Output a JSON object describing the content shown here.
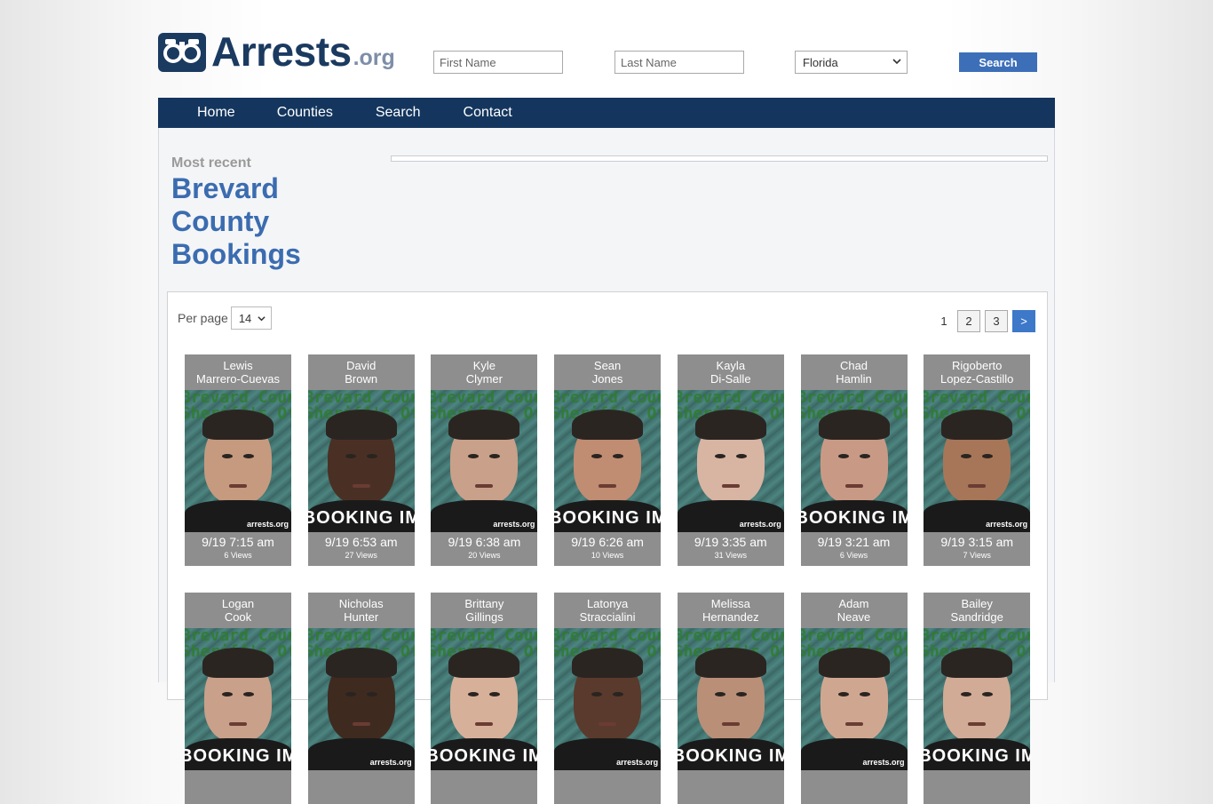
{
  "site": {
    "logo_text": "Arrests",
    "logo_suffix": ".org",
    "logo_icon": "handcuffs-icon"
  },
  "search": {
    "first_placeholder": "First Name",
    "last_placeholder": "Last Name",
    "state_value": "Florida",
    "button_label": "Search"
  },
  "nav": {
    "items": [
      "Home",
      "Counties",
      "Search",
      "Contact"
    ]
  },
  "page": {
    "kicker": "Most recent",
    "title_line1": "Brevard",
    "title_line2": "County",
    "title_line3": "Bookings"
  },
  "listing": {
    "per_page_label": "Per page",
    "per_page_value": "14",
    "pages": [
      "1",
      "2",
      "3"
    ],
    "current_page": "1",
    "next_label": ">"
  },
  "watermark": {
    "line1": "Brevard County",
    "line2": "Sheriff's Office",
    "site": "arrests.org",
    "stamp": "BOOKING IMAGE"
  },
  "bookings": [
    {
      "first": "Lewis",
      "last": "Marrero-Cuevas",
      "time": "9/19 7:15 am",
      "views": "6 Views"
    },
    {
      "first": "David",
      "last": "Brown",
      "time": "9/19 6:53 am",
      "views": "27 Views"
    },
    {
      "first": "Kyle",
      "last": "Clymer",
      "time": "9/19 6:38 am",
      "views": "20 Views"
    },
    {
      "first": "Sean",
      "last": "Jones",
      "time": "9/19 6:26 am",
      "views": "10 Views"
    },
    {
      "first": "Kayla",
      "last": "Di-Salle",
      "time": "9/19 3:35 am",
      "views": "31 Views"
    },
    {
      "first": "Chad",
      "last": "Hamlin",
      "time": "9/19 3:21 am",
      "views": "6 Views"
    },
    {
      "first": "Rigoberto",
      "last": "Lopez-Castillo",
      "time": "9/19 3:15 am",
      "views": "7 Views"
    },
    {
      "first": "Logan",
      "last": "Cook",
      "time": "",
      "views": ""
    },
    {
      "first": "Nicholas",
      "last": "Hunter",
      "time": "",
      "views": ""
    },
    {
      "first": "Brittany",
      "last": "Gillings",
      "time": "",
      "views": ""
    },
    {
      "first": "Latonya",
      "last": "Straccialini",
      "time": "",
      "views": ""
    },
    {
      "first": "Melissa",
      "last": "Hernandez",
      "time": "",
      "views": ""
    },
    {
      "first": "Adam",
      "last": "Neave",
      "time": "",
      "views": ""
    },
    {
      "first": "Bailey",
      "last": "Sandridge",
      "time": "",
      "views": ""
    }
  ],
  "colors": {
    "brand_navy": "#14365e",
    "link_blue": "#3b6cb0",
    "button_blue": "#3d6fb8",
    "card_gray": "#8f8e8e"
  }
}
